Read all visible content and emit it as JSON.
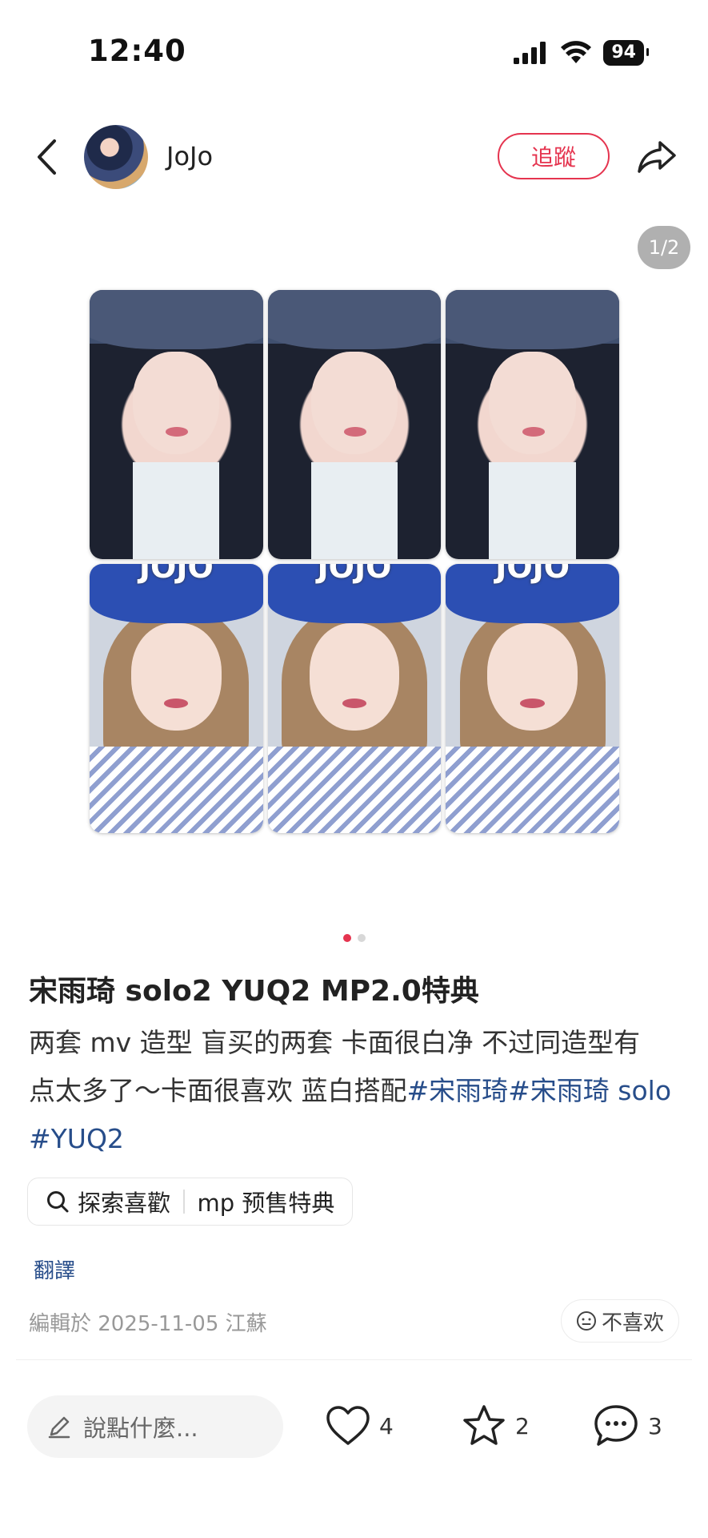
{
  "status_bar": {
    "time": "12:40",
    "battery": "94"
  },
  "header": {
    "author": "JoJo",
    "follow_label": "追蹤"
  },
  "carousel": {
    "page_counter": "1/2",
    "card_label": "JOJO",
    "active_index": 0,
    "total_pages": 2
  },
  "post": {
    "title": "宋雨琦 solo2 YUQ2 MP2.0特典",
    "body_lines": [
      "两套 mv 造型 盲买的两套 卡面很白净 不过同造型有",
      "点太多了～卡面很喜欢 蓝白搭配"
    ],
    "hashtags": [
      "#宋雨琦",
      "#宋雨琦 solo",
      "#YUQ2"
    ],
    "search_chip": {
      "label": "探索喜歡",
      "keyword": "mp 预售特典"
    },
    "translate_label": "翻譯",
    "edit_meta": "編輯於 2025-11-05 江蘇",
    "dislike_label": "不喜欢"
  },
  "bottom_bar": {
    "comment_placeholder": "說點什麼...",
    "likes": "4",
    "favorites": "2",
    "comments": "3"
  },
  "colors": {
    "accent": "#e5344f",
    "hashtag": "#274d8a"
  }
}
